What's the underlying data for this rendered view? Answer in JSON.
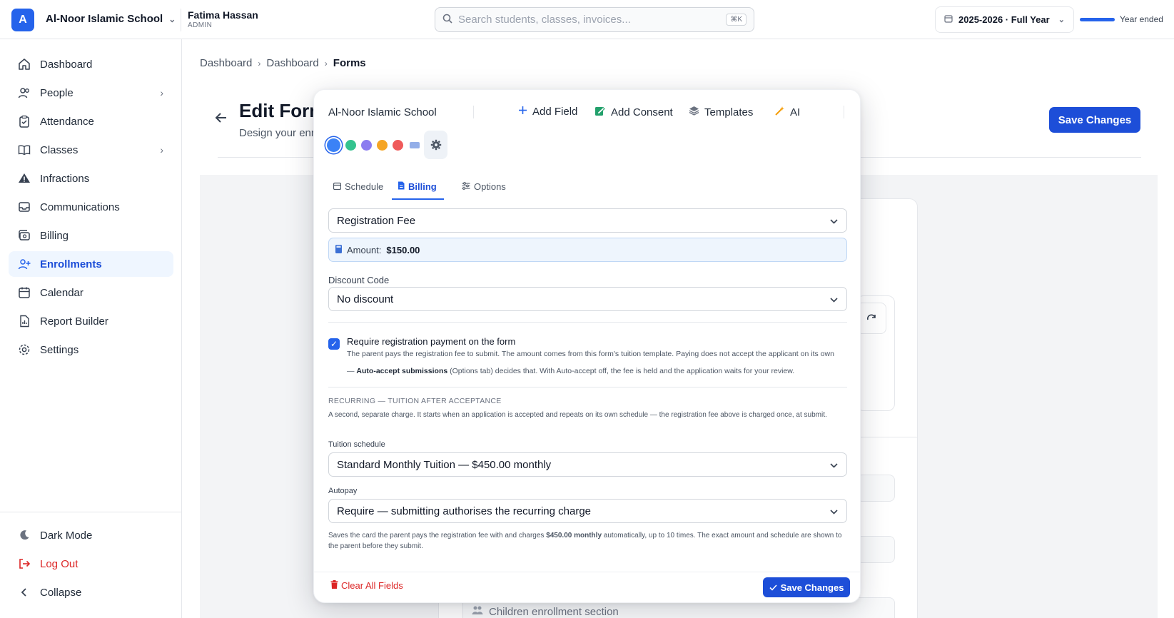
{
  "topbar": {
    "logo_letter": "A",
    "school_name": "Al-Noor Islamic School",
    "user_name": "Fatima Hassan",
    "user_role": "ADMIN",
    "search_placeholder": "Search students, classes, invoices...",
    "search_shortcut": "⌘K",
    "year_label": "2025-2026 · Full Year",
    "year_status": "Year ended"
  },
  "sidebar": {
    "items": [
      {
        "label": "Dashboard",
        "icon": "home-icon"
      },
      {
        "label": "People",
        "icon": "users-icon"
      },
      {
        "label": "Attendance",
        "icon": "clipboard-check-icon"
      },
      {
        "label": "Classes",
        "icon": "book-icon"
      },
      {
        "label": "Infractions",
        "icon": "warning-icon"
      },
      {
        "label": "Communications",
        "icon": "inbox-icon"
      },
      {
        "label": "Billing",
        "icon": "billing-icon"
      },
      {
        "label": "Enrollments",
        "icon": "user-plus-icon",
        "active": true
      },
      {
        "label": "Calendar",
        "icon": "calendar-icon"
      },
      {
        "label": "Report Builder",
        "icon": "report-icon"
      },
      {
        "label": "Settings",
        "icon": "gear-icon"
      }
    ],
    "dark_mode": "Dark Mode",
    "log_out": "Log Out",
    "collapse": "Collapse"
  },
  "breadcrumb": [
    "Dashboard",
    "Dashboard",
    "Forms"
  ],
  "page": {
    "title": "Edit Form",
    "subtitle": "Design your enr",
    "save_label": "Save Changes",
    "bg_field_label": "Children enrollment section"
  },
  "panel": {
    "school_name": "Al-Noor Islamic School",
    "tools": {
      "add_field": "Add Field",
      "add_consent": "Add Consent",
      "templates": "Templates",
      "ai": "AI"
    },
    "swatch_colors": [
      "#3b82f6",
      "#34c38f",
      "#8b7cf0",
      "#f5a524",
      "#ef5a5a"
    ],
    "tabs": [
      "Schedule",
      "Billing",
      "Options"
    ],
    "active_tab": "Billing",
    "tuition_template_value": "Registration Fee",
    "amount_label": "Amount:",
    "amount_value": "$150.00",
    "discount_label": "Discount Code",
    "discount_value": "No discount",
    "require_payment_label": "Require registration payment on the form",
    "require_payment_checked": true,
    "require_payment_help_1": "The parent pays the registration fee to submit. The amount comes from this form's tuition template. Paying does not accept the applicant on its own",
    "require_payment_help_2a": "— ",
    "require_payment_help_2b": "Auto-accept submissions",
    "require_payment_help_2c": " (Options tab) decides that. With Auto-accept off, the fee is held and the application waits for your review.",
    "recurring_heading": "RECURRING — TUITION AFTER ACCEPTANCE",
    "recurring_desc": "A second, separate charge. It starts when an application is accepted and repeats on its own schedule — the registration fee above is charged once, at submit.",
    "tuition_schedule_label": "Tuition schedule",
    "tuition_schedule_value": "Standard Monthly Tuition — $450.00 monthly",
    "autopay_label": "Autopay",
    "autopay_value": "Require — submitting authorises the recurring charge",
    "autopay_help_a": "Saves the card the parent pays the registration fee with and charges ",
    "autopay_help_b": "$450.00 monthly",
    "autopay_help_c": " automatically, up to 10 times. The exact amount and schedule are shown to the parent before they submit.",
    "clear_label": "Clear All Fields",
    "save_label": "Save Changes"
  },
  "colors": {
    "accent": "#2563eb",
    "danger": "#dc2626"
  }
}
